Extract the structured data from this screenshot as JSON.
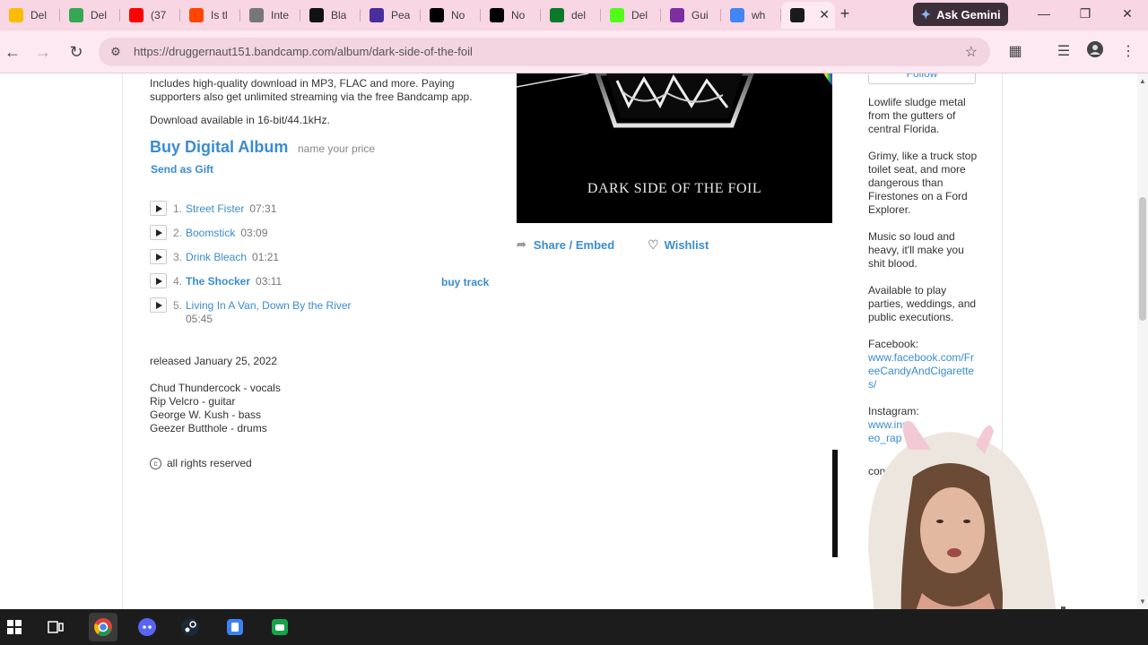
{
  "browser": {
    "tabs": [
      {
        "title": "Del",
        "icon": "google-drive-icon",
        "color": "#fbbc04"
      },
      {
        "title": "Del",
        "icon": "google-drive-icon",
        "color": "#34a853"
      },
      {
        "title": "(37",
        "icon": "youtube-icon",
        "color": "#ff0000"
      },
      {
        "title": "Is tl",
        "icon": "reddit-icon",
        "color": "#ff4500"
      },
      {
        "title": "Inte",
        "icon": "globe-icon",
        "color": "#777777"
      },
      {
        "title": "Bla",
        "icon": "wix-icon",
        "color": "#111111"
      },
      {
        "title": "Pea",
        "icon": "chart-icon",
        "color": "#4a2e9c"
      },
      {
        "title": "No",
        "icon": "x-icon",
        "color": "#000000"
      },
      {
        "title": "No",
        "icon": "x-icon",
        "color": "#000000"
      },
      {
        "title": "del",
        "icon": "green-square-icon",
        "color": "#0a7a2a"
      },
      {
        "title": "Del",
        "icon": "kick-icon",
        "color": "#53fc18"
      },
      {
        "title": "Gui",
        "icon": "peace-icon",
        "color": "#7b2fa0"
      },
      {
        "title": "wh",
        "icon": "google-icon",
        "color": "#4285f4"
      }
    ],
    "active_tab": {
      "icon": "bandcamp-icon",
      "close": "✕"
    },
    "new_tab": "+",
    "gemini_label": "Ask Gemini",
    "url": "https://druggernaut151.bandcamp.com/album/dark-side-of-the-foil"
  },
  "album": {
    "description": "Includes high-quality download in MP3, FLAC and more. Paying supporters also get unlimited streaming via the free Bandcamp app.",
    "format_note": "Download available in 16-bit/44.1kHz.",
    "buy_label": "Buy Digital Album",
    "price_label": "name your price",
    "gift_label": "Send as Gift",
    "tracks": [
      {
        "num": "1.",
        "name": "Street Fister",
        "time": "07:31"
      },
      {
        "num": "2.",
        "name": "Boomstick",
        "time": "03:09"
      },
      {
        "num": "3.",
        "name": "Drink Bleach",
        "time": "01:21"
      },
      {
        "num": "4.",
        "name": "The Shocker",
        "time": "03:11"
      },
      {
        "num": "5.",
        "name": "Living In A Van, Down By the River",
        "time": "05:45"
      }
    ],
    "buy_track_label": "buy track",
    "released": "released January 25, 2022",
    "credits": [
      "Chud Thundercock - vocals",
      "Rip Velcro - guitar",
      "George W. Kush - bass",
      "Geezer Butthole - drums"
    ],
    "rights": "all rights reserved",
    "art_title": "DARK SIDE OF THE FOIL",
    "share_label": "Share / Embed",
    "wishlist_label": "Wishlist"
  },
  "artist": {
    "follow_label": "Follow",
    "bio": [
      "Lowlife sludge metal from the gutters of central Florida.",
      "Grimy, like a truck stop toilet seat, and more dangerous than Firestones on a Ford Explorer.",
      "Music so loud and heavy, it'll make you shit blood.",
      "Available to play parties, weddings, and public executions."
    ],
    "facebook_label": "Facebook:",
    "facebook_url": "www.facebook.com/FreeCandyAndCigarettes/",
    "instagram_label": "Instagram:",
    "instagram_url": "www.inst",
    "instagram_url2": "eo_rap",
    "contact_partial": "con"
  }
}
